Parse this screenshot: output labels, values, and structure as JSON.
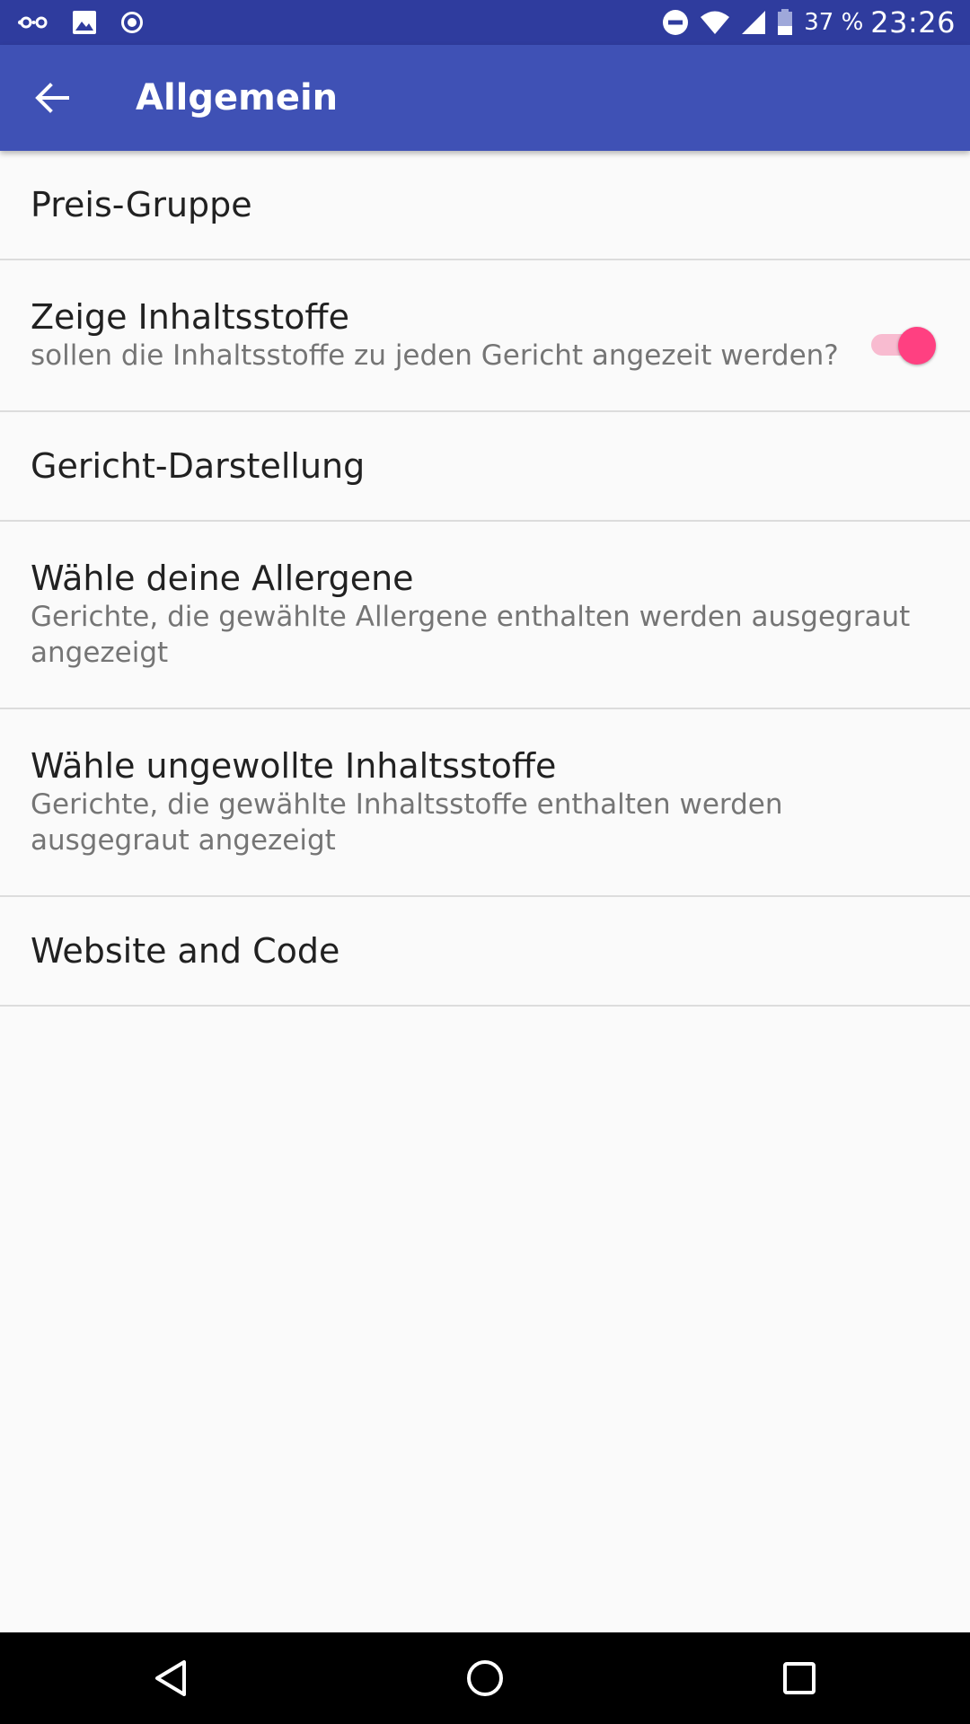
{
  "status_bar": {
    "battery_percent": "37 %",
    "time": "23:26",
    "left_icons": [
      "nextcloud-icon",
      "image-icon",
      "record-icon"
    ],
    "right_icons": [
      "do-not-disturb-icon",
      "wifi-icon",
      "cell-signal-icon",
      "battery-icon"
    ]
  },
  "app_bar": {
    "title": "Allgemein",
    "back_icon": "arrow-back-icon",
    "background_color": "#3f51b5"
  },
  "preferences": [
    {
      "title": "Preis-Gruppe"
    },
    {
      "title": "Zeige Inhaltsstoffe",
      "summary": "sollen die Inhaltsstoffe zu jeden Gericht angezeit werden?",
      "switch_on": true
    },
    {
      "title": "Gericht-Darstellung"
    },
    {
      "title": "Wähle deine Allergene",
      "summary": "Gerichte, die gewählte Allergene enthalten werden ausgegraut angezeigt"
    },
    {
      "title": "Wähle ungewollte Inhaltsstoffe",
      "summary": "Gerichte, die gewählte Inhaltsstoffe enthalten werden ausgegraut angezeigt"
    },
    {
      "title": "Website and Code"
    }
  ],
  "accent_color": "#ff4081",
  "nav_bar": {
    "icons": [
      "back-triangle-icon",
      "home-circle-icon",
      "recents-square-icon"
    ]
  }
}
